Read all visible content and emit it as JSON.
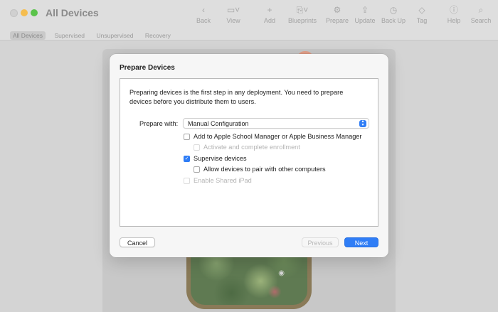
{
  "window": {
    "title": "All Devices"
  },
  "toolbar": {
    "items": [
      {
        "label": "Back",
        "icon": "chevron-left-icon"
      },
      {
        "label": "View",
        "icon": "view-icon"
      },
      {
        "label": "Add",
        "icon": "plus-icon"
      },
      {
        "label": "Blueprints",
        "icon": "blueprints-icon"
      },
      {
        "label": "Prepare",
        "icon": "gear-icon"
      },
      {
        "label": "Update",
        "icon": "update-icon"
      },
      {
        "label": "Back Up",
        "icon": "backup-icon"
      },
      {
        "label": "Tag",
        "icon": "tag-icon"
      },
      {
        "label": "Help",
        "icon": "help-icon"
      },
      {
        "label": "Search",
        "icon": "search-icon"
      }
    ]
  },
  "filters": [
    "All Devices",
    "Supervised",
    "Unsupervised",
    "Recovery"
  ],
  "dialog": {
    "title": "Prepare Devices",
    "intro": "Preparing devices is the first step in any deployment. You need to prepare devices before you distribute them to users.",
    "prepare_with_label": "Prepare with:",
    "prepare_with_value": "Manual Configuration",
    "options": {
      "add_to_manager": "Add to Apple School Manager or Apple Business Manager",
      "activate_enrollment": "Activate and complete enrollment",
      "supervise": "Supervise devices",
      "allow_pairing": "Allow devices to pair with other computers",
      "shared_ipad": "Enable Shared iPad"
    },
    "buttons": {
      "cancel": "Cancel",
      "previous": "Previous",
      "next": "Next"
    }
  },
  "colors": {
    "accent": "#2f7df6",
    "close": "#d0d0d0",
    "minimize": "#f5bd4f",
    "maximize": "#5ac34a"
  }
}
